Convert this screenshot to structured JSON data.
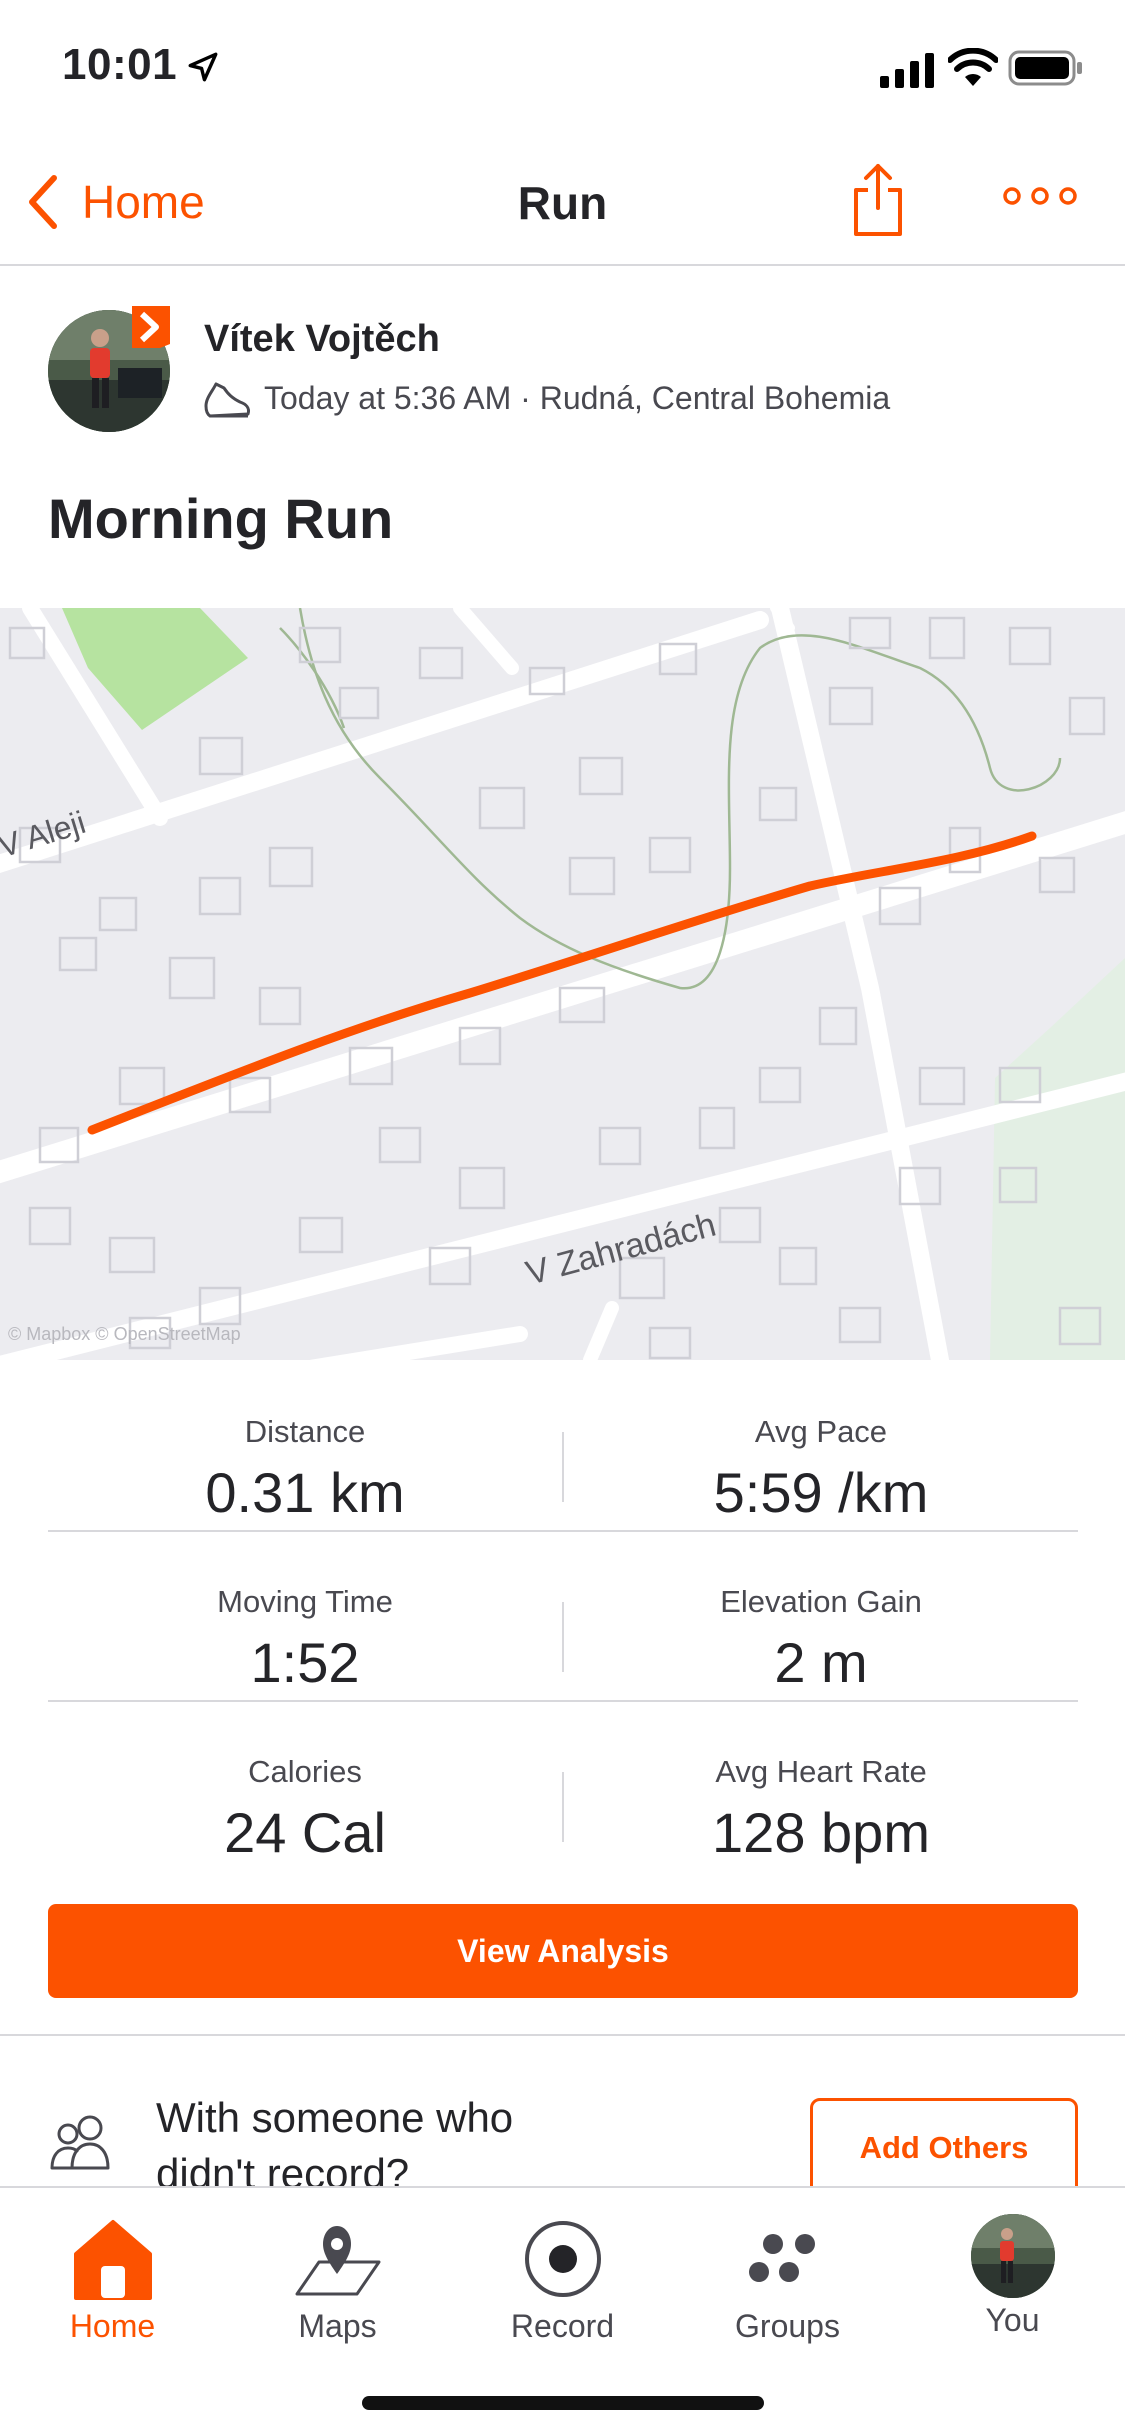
{
  "status_bar": {
    "time": "10:01"
  },
  "nav": {
    "back_label": "Home",
    "title": "Run"
  },
  "athlete": {
    "name": "Vítek Vojtěch",
    "meta": "Today at 5:36 AM · Rudná, Central Bohemia"
  },
  "activity": {
    "title": "Morning Run"
  },
  "map": {
    "street_1": "V Aleji",
    "street_2": "V Zahradách",
    "attribution": "© Mapbox © OpenStreetMap",
    "route_color": "#fc5200"
  },
  "stats": [
    {
      "left_label": "Distance",
      "left_value": "0.31 km",
      "right_label": "Avg Pace",
      "right_value": "5:59 /km"
    },
    {
      "left_label": "Moving Time",
      "left_value": "1:52",
      "right_label": "Elevation Gain",
      "right_value": "2 m"
    },
    {
      "left_label": "Calories",
      "left_value": "24 Cal",
      "right_label": "Avg Heart Rate",
      "right_value": "128 bpm"
    }
  ],
  "actions": {
    "view_analysis": "View Analysis",
    "add_others": "Add Others"
  },
  "others": {
    "text": "With someone who didn't record?"
  },
  "tabs": [
    {
      "label": "Home",
      "icon": "home-icon"
    },
    {
      "label": "Maps",
      "icon": "map-pin-icon"
    },
    {
      "label": "Record",
      "icon": "record-icon"
    },
    {
      "label": "Groups",
      "icon": "groups-icon"
    },
    {
      "label": "You",
      "icon": "avatar"
    }
  ],
  "colors": {
    "accent": "#fc5200",
    "text": "#242428",
    "divider": "#d8d8dc"
  }
}
